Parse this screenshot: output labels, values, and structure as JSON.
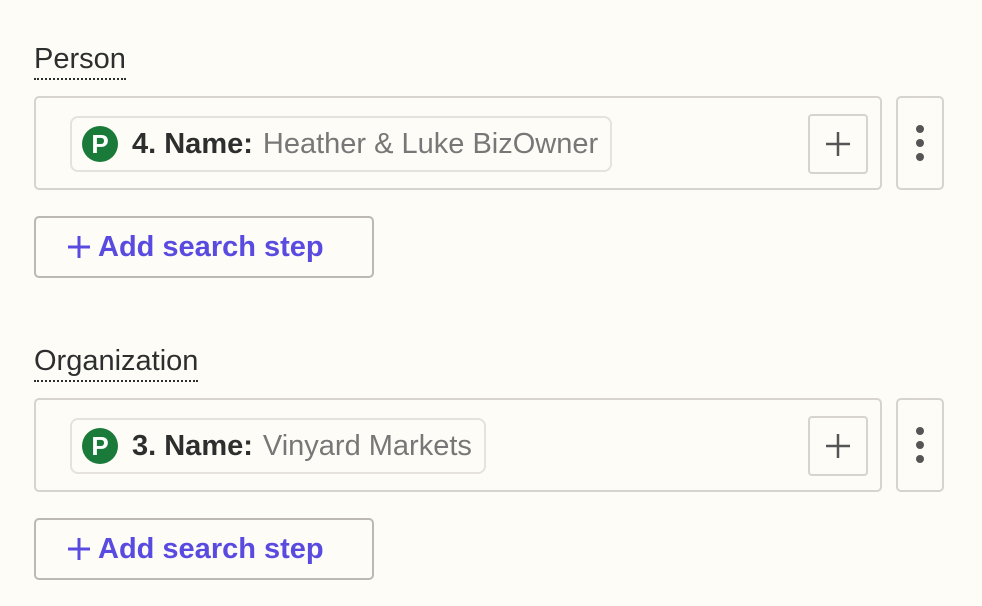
{
  "sections": [
    {
      "label": "Person",
      "pill": {
        "app_icon_letter": "P",
        "key": "4. Name:",
        "value": "Heather & Luke BizOwner"
      },
      "add_search_step_label": "Add search step"
    },
    {
      "label": "Organization",
      "pill": {
        "app_icon_letter": "P",
        "key": "3. Name:",
        "value": "Vinyard Markets"
      },
      "add_search_step_label": "Add search step"
    }
  ],
  "icons": {
    "app": "pipedrive-icon",
    "insert": "plus-icon",
    "more": "more-vertical-icon",
    "add": "plus-icon"
  },
  "colors": {
    "background": "#fdfcf7",
    "app_icon": "#1a7a3a",
    "accent": "#5a4be0",
    "muted_text": "#787777",
    "border": "#d7d3cf"
  }
}
